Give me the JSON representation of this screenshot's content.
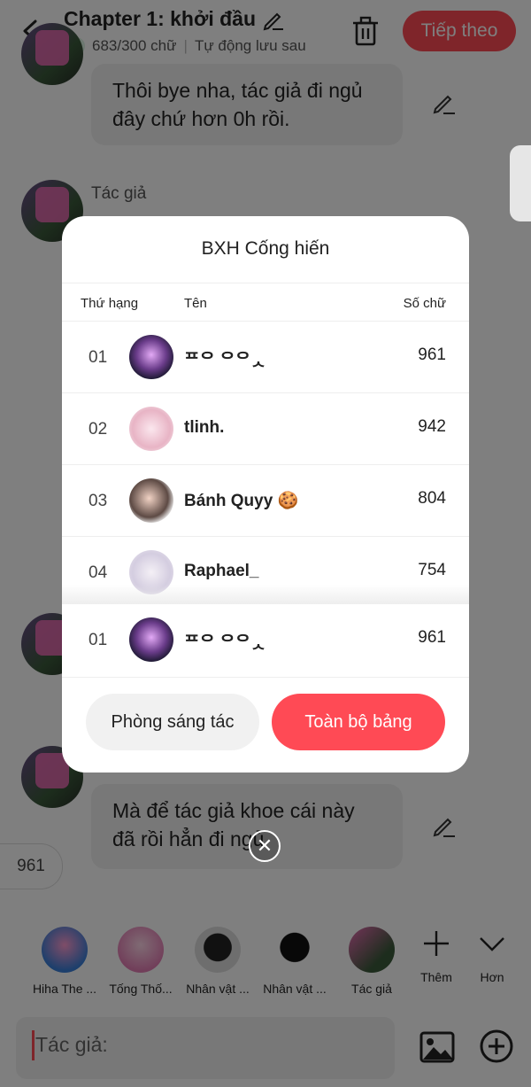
{
  "header": {
    "title": "Chapter 1: khởi đầu",
    "word_count": "683/300 chữ",
    "autosave": "Tự động lưu sau",
    "next_label": "Tiếp theo"
  },
  "chat": {
    "message1": "Thôi bye nha, tác giả đi ngủ đây chứ hơn 0h rồi.",
    "author_label": "Tác giả",
    "message2": "Mà để tác giả khoe cái này đã rồi hẳn đi ngủ",
    "counter_chip": "961"
  },
  "characters": [
    {
      "label": "Hiha The ..."
    },
    {
      "label": "Tống Thố..."
    },
    {
      "label": "Nhân vật ..."
    },
    {
      "label": "Nhân vật ..."
    },
    {
      "label": "Tác giả"
    }
  ],
  "controls": {
    "add_label": "Thêm",
    "more_label": "Hơn"
  },
  "composer": {
    "placeholder": "Tác giả:"
  },
  "modal": {
    "title": "BXH Cống hiến",
    "col_rank": "Thứ hạng",
    "col_name": "Tên",
    "col_words": "Số chữ",
    "rows": [
      {
        "rank": "01",
        "name": "ᄑᄋ ᄋᄋᆺ",
        "score": "961"
      },
      {
        "rank": "02",
        "name": "tlinh.",
        "score": "942"
      },
      {
        "rank": "03",
        "name": "Bánh Quyy 🍪",
        "score": "804"
      },
      {
        "rank": "04",
        "name": "Raphael_",
        "score": "754"
      }
    ],
    "mine": {
      "rank": "01",
      "name": "ᄑᄋ ᄋᄋᆺ",
      "score": "961"
    },
    "btn_studio": "Phòng sáng tác",
    "btn_full": "Toàn bộ bảng"
  },
  "colors": {
    "accent": "#ff4a55",
    "overlay": "rgba(0,0,0,0.5)"
  }
}
